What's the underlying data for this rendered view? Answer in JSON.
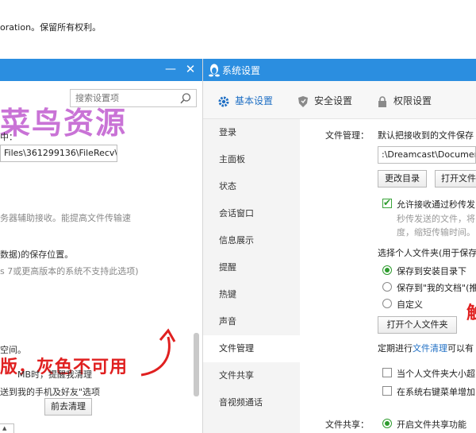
{
  "top": {
    "text": "oration。保留所有权利。"
  },
  "left_window": {
    "search_placeholder": "搜索设置项",
    "minimize": "—",
    "close": "✕",
    "watermark": "菜鸟资源",
    "line_receive_suffix": "中：",
    "path_value": "Files\\361299136\\FileRecv\\",
    "server_assist": "务器辅助接收。能提高文件传输速",
    "save_location": "数据)的保存位置。",
    "win7_note": "s 7或更高版本的系统不支持此选项)",
    "annotation": "版，灰色不可用",
    "space": "空间。",
    "clear_button": "前去清理",
    "mb_remind": "MB时，提醒我清理",
    "send_option": "送到我的手机及好友\"选项"
  },
  "right_window": {
    "title": "系统设置",
    "tabs": [
      {
        "label": "基本设置",
        "icon": "gear-icon",
        "active": true
      },
      {
        "label": "安全设置",
        "icon": "shield-icon",
        "active": false
      },
      {
        "label": "权限设置",
        "icon": "lock-icon",
        "active": false
      }
    ],
    "nav": [
      "登录",
      "主面板",
      "状态",
      "会话窗口",
      "信息展示",
      "提醒",
      "热键",
      "声音",
      "文件管理",
      "文件共享",
      "音视频通话"
    ],
    "nav_active_index": 8,
    "file_mgmt_label": "文件管理：",
    "default_save": "默认把接收到的文件保存",
    "path_value": ":\\Dreamcast\\Documen",
    "change_dir_button": "更改目录",
    "open_file_button": "打开文件",
    "allow_fast": "允许接收通过秒传发",
    "fast_desc_1": "秒传发送的文件，将",
    "fast_desc_2": "度，缩短传输时间。",
    "choose_folder": "选择个人文件夹(用于保存",
    "radio_install": "保存到安装目录下",
    "radio_mydocs": "保存到\"我的文档\"(推",
    "radio_custom": "自定义",
    "open_personal_button": "打开个人文件夹",
    "annotation": "触",
    "periodic_prefix": "定期进行",
    "periodic_link": "文件清理",
    "periodic_suffix": "可以有",
    "cb_exceed": "当个人文件夹大小超",
    "cb_contextmenu": "在系统右键菜单增加",
    "share_label": "文件共享：",
    "share_option": "开启文件共享功能"
  }
}
